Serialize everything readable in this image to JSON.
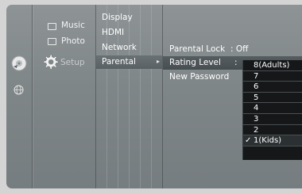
{
  "media_menu": {
    "music": "Music",
    "photo": "Photo",
    "setup": "Setup"
  },
  "setup_menu": {
    "display": "Display",
    "hdmi": "HDMI",
    "network": "Network",
    "parental": "Parental"
  },
  "parental_options": {
    "parental_lock_label": "Parental Lock",
    "parental_lock_value": ": Off",
    "rating_level_label": "Rating Level",
    "rating_level_colon": ":",
    "new_password_label": "New Password"
  },
  "rating_dropdown": {
    "options": [
      "8(Adults)",
      "7",
      "6",
      "5",
      "4",
      "3",
      "2",
      "1(Kids)"
    ],
    "checked_index": 7
  },
  "icons": [
    "disc-icon",
    "gear-icon",
    "globe-icon",
    "music-icon",
    "photo-icon",
    "checkmark-icon"
  ]
}
